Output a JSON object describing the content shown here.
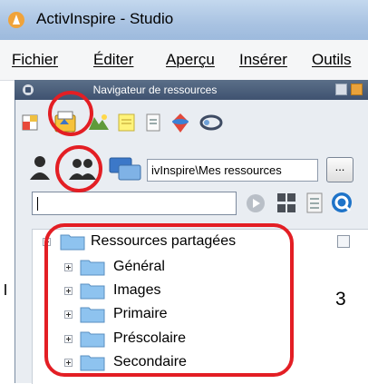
{
  "window": {
    "title": "ActivInspire - Studio"
  },
  "menu": [
    {
      "label": "Fichier"
    },
    {
      "label": "Éditer"
    },
    {
      "label": "Aperçu"
    },
    {
      "label": "Insérer"
    },
    {
      "label": "Outils"
    }
  ],
  "navigator": {
    "title": "Navigateur de ressources",
    "path_value": "ivInspire\\Mes ressources",
    "browse_label": "...",
    "search_value": ""
  },
  "tree": {
    "root": "Ressources partagées",
    "items": [
      {
        "label": "Général"
      },
      {
        "label": "Images"
      },
      {
        "label": "Primaire"
      },
      {
        "label": "Préscolaire"
      },
      {
        "label": "Secondaire"
      }
    ]
  },
  "annotation": {
    "number": "3"
  },
  "colors": {
    "highlight": "#e31e24",
    "header": "#4a5d7a",
    "folder": "#8ec3ef"
  }
}
